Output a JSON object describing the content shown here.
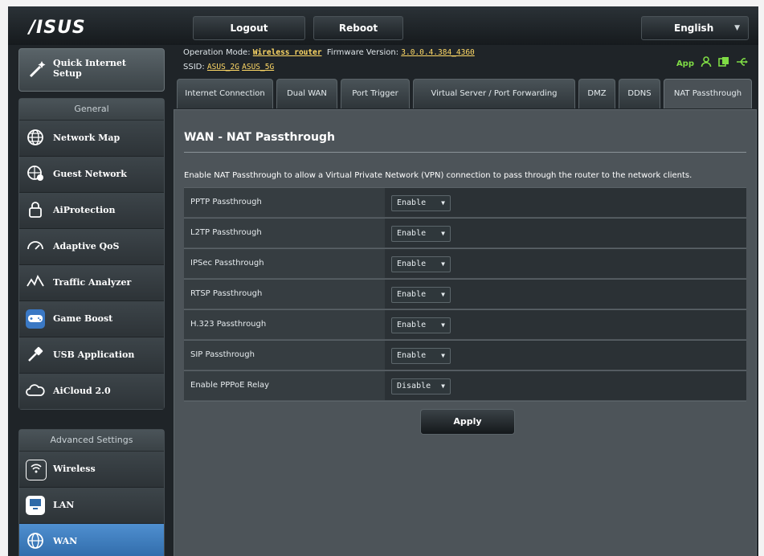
{
  "header": {
    "logo": "/ISUS",
    "logout_label": "Logout",
    "reboot_label": "Reboot",
    "language": "English"
  },
  "info": {
    "operation_mode_label": "Operation Mode:",
    "operation_mode_value": "Wireless router",
    "firmware_label": "Firmware Version:",
    "firmware_value": "3.0.0.4.384_4360",
    "ssid_label": "SSID:",
    "ssid_1": "ASUS_2G",
    "ssid_2": "ASUS_5G",
    "app_label": "App"
  },
  "sidebar": {
    "quick_setup": "Quick Internet Setup",
    "general_header": "General",
    "general_items": [
      {
        "label": "Network Map",
        "icon": "globe-icon"
      },
      {
        "label": "Guest Network",
        "icon": "guest-globe-icon"
      },
      {
        "label": "AiProtection",
        "icon": "lock-icon"
      },
      {
        "label": "Adaptive QoS",
        "icon": "gauge-icon"
      },
      {
        "label": "Traffic Analyzer",
        "icon": "analyzer-icon"
      },
      {
        "label": "Game Boost",
        "icon": "gamepad-icon"
      },
      {
        "label": "USB Application",
        "icon": "usb-icon"
      },
      {
        "label": "AiCloud 2.0",
        "icon": "cloud-icon"
      }
    ],
    "advanced_header": "Advanced Settings",
    "advanced_items": [
      {
        "label": "Wireless",
        "icon": "wifi-icon"
      },
      {
        "label": "LAN",
        "icon": "monitor-icon"
      },
      {
        "label": "WAN",
        "icon": "wan-globe-icon",
        "active": true
      }
    ]
  },
  "tabs": [
    {
      "label": "Internet Connection"
    },
    {
      "label": "Dual WAN"
    },
    {
      "label": "Port Trigger"
    },
    {
      "label": "Virtual Server / Port Forwarding"
    },
    {
      "label": "DMZ"
    },
    {
      "label": "DDNS"
    },
    {
      "label": "NAT Passthrough",
      "active": true
    }
  ],
  "main": {
    "title": "WAN - NAT Passthrough",
    "description": "Enable NAT Passthrough to allow a Virtual Private Network (VPN) connection to pass through the router to the network clients.",
    "rows": [
      {
        "label": "PPTP Passthrough",
        "value": "Enable"
      },
      {
        "label": "L2TP Passthrough",
        "value": "Enable"
      },
      {
        "label": "IPSec Passthrough",
        "value": "Enable"
      },
      {
        "label": "RTSP Passthrough",
        "value": "Enable"
      },
      {
        "label": "H.323 Passthrough",
        "value": "Enable"
      },
      {
        "label": "SIP Passthrough",
        "value": "Enable"
      },
      {
        "label": "Enable PPPoE Relay",
        "value": "Disable"
      }
    ],
    "apply_label": "Apply"
  },
  "colors": {
    "accent_active": "#3f7fc0",
    "status_green": "#7fdc45",
    "link_yellow": "#ffd966"
  }
}
